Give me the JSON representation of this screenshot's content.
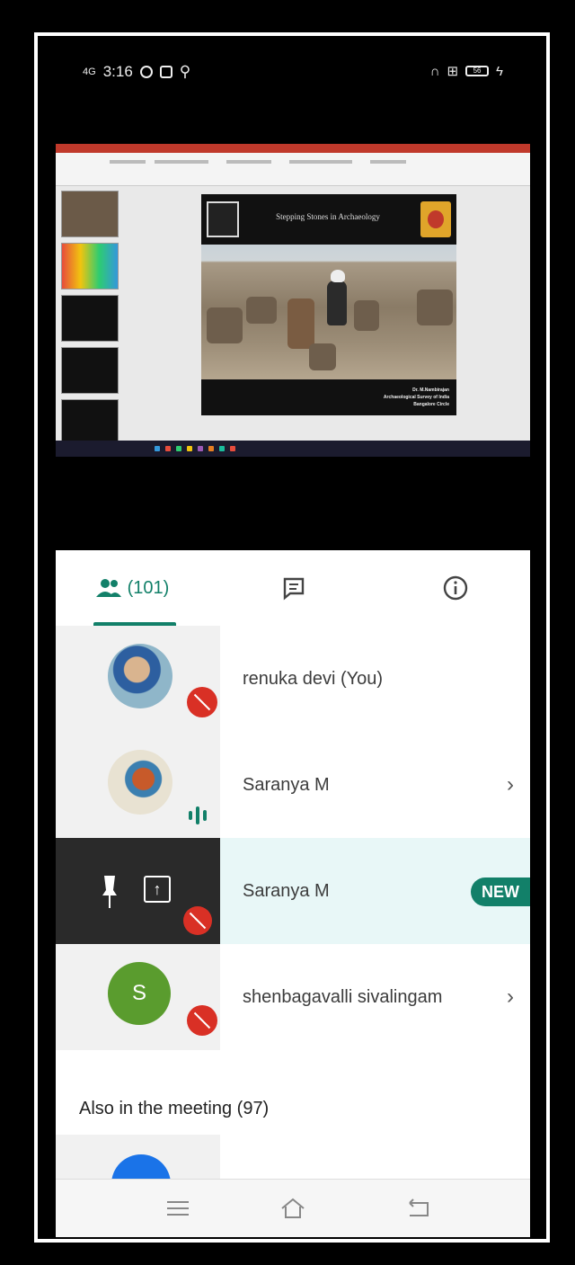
{
  "status_bar": {
    "network": "4G",
    "time": "3:16",
    "right_icons": [
      "headphones-icon",
      "signal-icon",
      "battery-icon",
      "charging-icon"
    ],
    "battery": "56"
  },
  "shared_screen": {
    "slide_title": "Stepping Stones in Archaeology",
    "caption_lines": [
      "Dr. M.Nambirajan",
      "Archaeological Survey of India",
      "Bangalore Circle"
    ]
  },
  "tabs": {
    "people_count": "(101)",
    "chat_icon": "chat-icon",
    "info_icon": "info-icon"
  },
  "participants": [
    {
      "name": "renuka devi (You)",
      "status": "muted"
    },
    {
      "name": "Saranya M",
      "status": "speaking"
    },
    {
      "name": "Saranya M",
      "status": "presenting",
      "badge": "NEW"
    },
    {
      "name": "shenbagavalli sivalingam",
      "status": "muted",
      "initial": "S"
    }
  ],
  "also_in_meeting": "Also in the meeting (97)",
  "colors": {
    "accent": "#128069",
    "muted": "#d93025",
    "highlight": "#e8f7f7"
  }
}
